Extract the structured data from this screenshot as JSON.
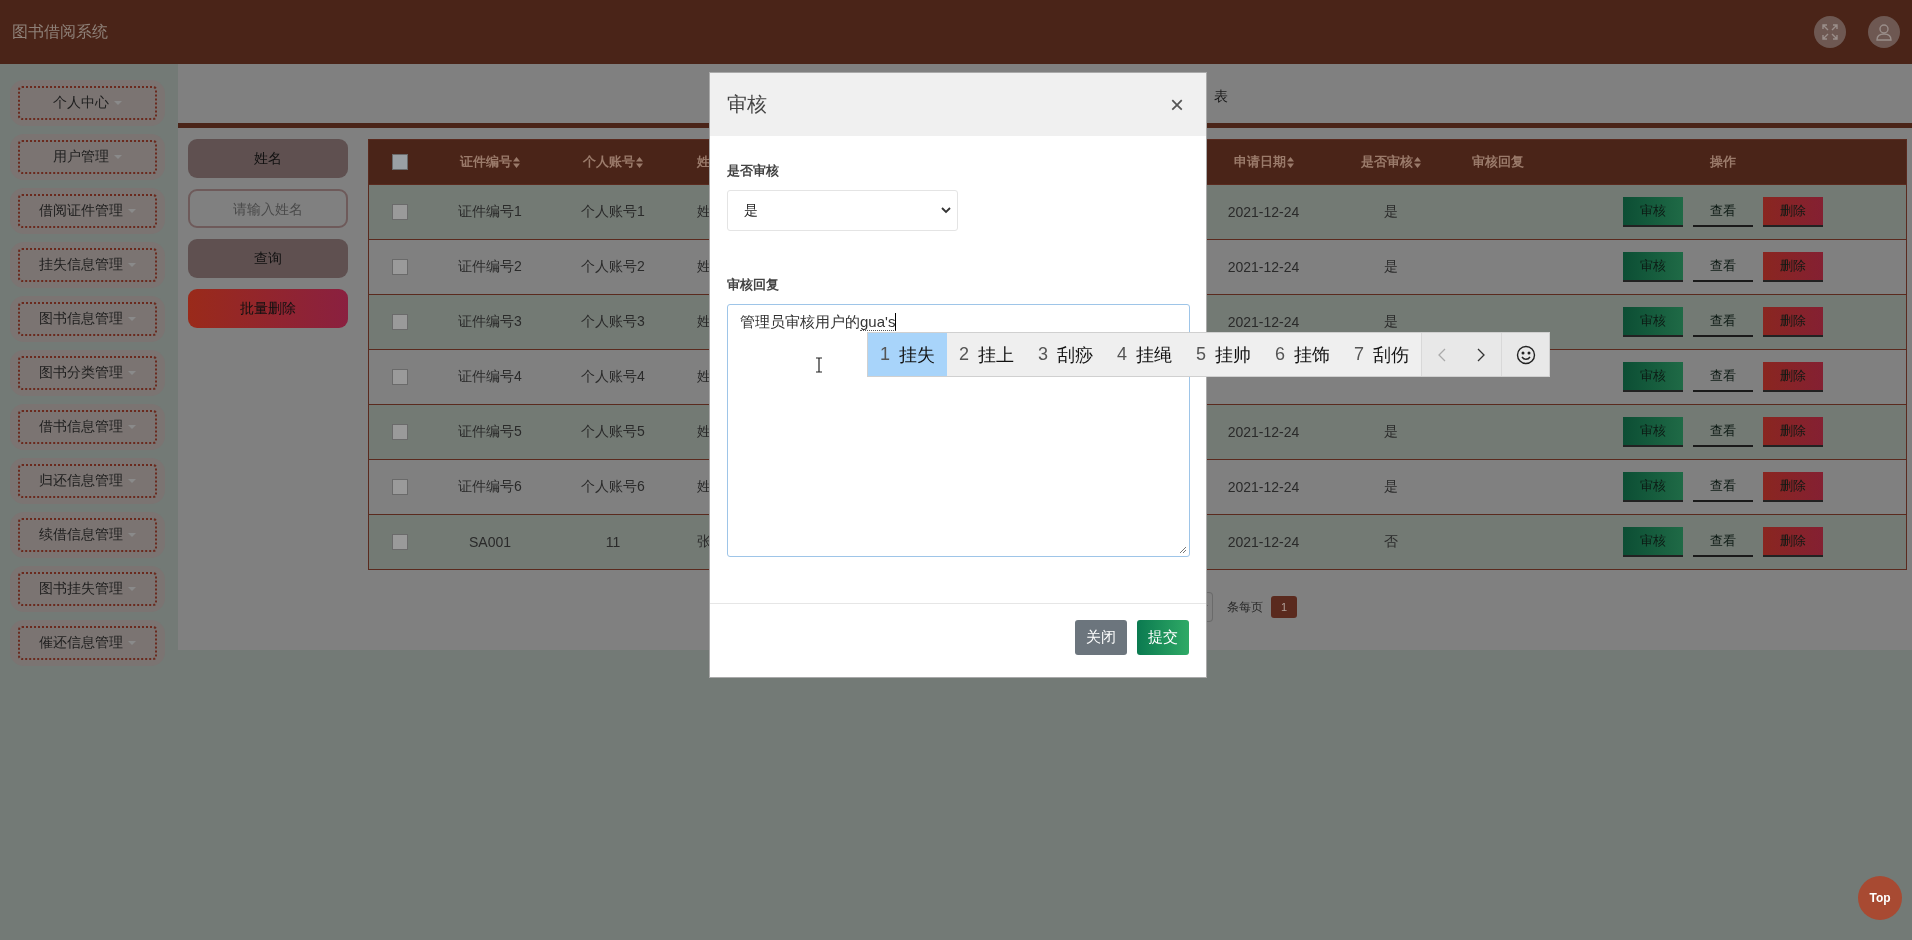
{
  "app_title": "图书借阅系统",
  "sidebar": {
    "items": [
      {
        "label": "个人中心"
      },
      {
        "label": "用户管理"
      },
      {
        "label": "借阅证件管理"
      },
      {
        "label": "挂失信息管理"
      },
      {
        "label": "图书信息管理"
      },
      {
        "label": "图书分类管理"
      },
      {
        "label": "借书信息管理"
      },
      {
        "label": "归还信息管理"
      },
      {
        "label": "续借信息管理"
      },
      {
        "label": "图书挂失管理"
      },
      {
        "label": "催还信息管理"
      }
    ]
  },
  "page_title": "表",
  "search": {
    "field_label": "姓名",
    "placeholder": "请输入姓名",
    "buttons": [
      {
        "label": "查询",
        "kind": "search"
      },
      {
        "label": "批量删除",
        "kind": "delete"
      }
    ]
  },
  "table": {
    "header_checked": false,
    "columns": [
      {
        "label": "证件编号",
        "sortable": true
      },
      {
        "label": "个人账号",
        "sortable": true
      },
      {
        "label": "姓",
        "sortable": false
      },
      {
        "label": "申请日期",
        "sortable": true
      },
      {
        "label": "是否审核",
        "sortable": true
      },
      {
        "label": "审核回复",
        "sortable": false
      },
      {
        "label": "操作",
        "sortable": false
      }
    ],
    "rows": [
      {
        "checked": false,
        "cells": [
          "证件编号1",
          "个人账号1",
          "姓",
          "2021-12-24",
          "是"
        ],
        "actions": [
          "审核",
          "查看",
          "删除"
        ]
      },
      {
        "checked": false,
        "cells": [
          "证件编号2",
          "个人账号2",
          "姓",
          "2021-12-24",
          "是"
        ],
        "actions": [
          "审核",
          "查看",
          "删除"
        ]
      },
      {
        "checked": false,
        "cells": [
          "证件编号3",
          "个人账号3",
          "姓",
          "2021-12-24",
          "是"
        ],
        "actions": [
          "审核",
          "查看",
          "删除"
        ]
      },
      {
        "checked": false,
        "cells": [
          "证件编号4",
          "个人账号4",
          "姓"
        ],
        "actions": [
          "审核",
          "查看",
          "删除"
        ]
      },
      {
        "checked": false,
        "cells": [
          "证件编号5",
          "个人账号5",
          "姓",
          "2021-12-24",
          "是"
        ],
        "actions": [
          "审核",
          "查看",
          "删除"
        ]
      },
      {
        "checked": false,
        "cells": [
          "证件编号6",
          "个人账号6",
          "姓",
          "2021-12-24",
          "是"
        ],
        "actions": [
          "审核",
          "查看",
          "删除"
        ]
      },
      {
        "checked": false,
        "cells": [
          "SA001",
          "11",
          "张",
          "2021-12-24",
          "否"
        ],
        "actions": [
          "审核",
          "查看",
          "删除"
        ]
      }
    ]
  },
  "pagination": {
    "per_page_label": "条每页",
    "pages": [
      {
        "label": "1",
        "selected": true
      }
    ]
  },
  "modal": {
    "title": "审核",
    "close": "×",
    "fields": [
      {
        "kind": "select",
        "label": "是否审核",
        "value": "是"
      },
      {
        "kind": "textarea",
        "label": "审核回复",
        "value": "管理员审核用户的",
        "composition": "gua's"
      }
    ],
    "buttons": [
      {
        "label": "关闭",
        "kind": "secondary"
      },
      {
        "label": "提交",
        "kind": "primary"
      }
    ]
  },
  "ime": {
    "candidates": [
      {
        "number": "1",
        "text": "挂失",
        "selected": true
      },
      {
        "number": "2",
        "text": "挂上",
        "selected": false
      },
      {
        "number": "3",
        "text": "刮痧",
        "selected": false
      },
      {
        "number": "4",
        "text": "挂绳",
        "selected": false
      },
      {
        "number": "5",
        "text": "挂帅",
        "selected": false
      },
      {
        "number": "6",
        "text": "挂饰",
        "selected": false
      },
      {
        "number": "7",
        "text": "刮伤",
        "selected": false
      }
    ]
  },
  "top_button": "Top"
}
